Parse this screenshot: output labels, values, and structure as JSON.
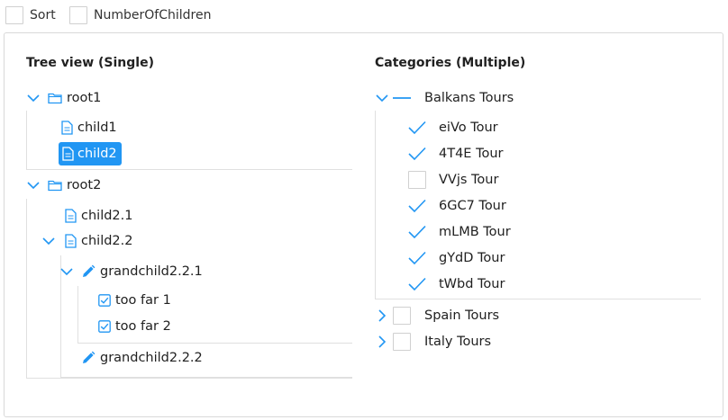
{
  "toolbar": {
    "sort_label": "Sort",
    "children_label": "NumberOfChildren"
  },
  "tree": {
    "title": "Tree view (Single)",
    "root1": {
      "label": "root1",
      "children": [
        "child1",
        "child2"
      ]
    },
    "root2": {
      "label": "root2",
      "child21": "child2.1",
      "child22": "child2.2",
      "gc221": "grandchild2.2.1",
      "toofar1": "too far 1",
      "toofar2": "too far 2",
      "gc222": "grandchild2.2.2"
    },
    "selected": "child2"
  },
  "categories": {
    "title": "Categories (Multiple)",
    "balkans": {
      "label": "Balkans Tours",
      "tours": [
        {
          "label": "eiVo Tour",
          "checked": true
        },
        {
          "label": "4T4E Tour",
          "checked": true
        },
        {
          "label": "VVjs Tour",
          "checked": false
        },
        {
          "label": "6GC7 Tour",
          "checked": true
        },
        {
          "label": "mLMB Tour",
          "checked": true
        },
        {
          "label": "gYdD Tour",
          "checked": true
        },
        {
          "label": "tWbd Tour",
          "checked": true
        }
      ]
    },
    "spain": {
      "label": "Spain Tours"
    },
    "italy": {
      "label": "Italy Tours"
    }
  },
  "colors": {
    "accent": "#2196f3",
    "border": "#d9d9d9"
  }
}
